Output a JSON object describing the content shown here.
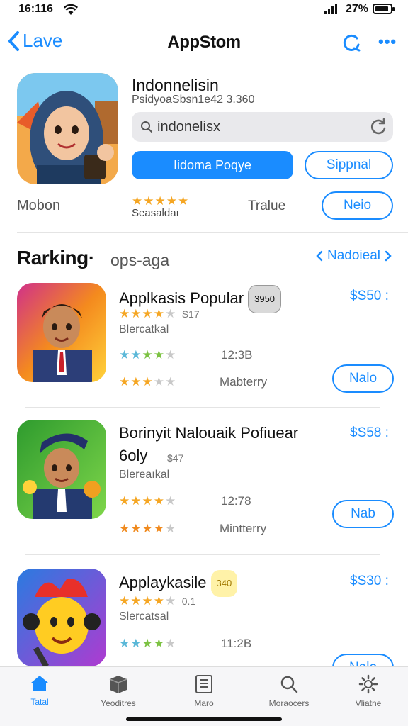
{
  "status": {
    "time": "16:116",
    "battery": "27%"
  },
  "nav": {
    "back_label": "Lave",
    "title": "AppStom"
  },
  "featured": {
    "title": "Indonnelisin",
    "subtitle": "PsidyoaSbsn1e42 3.360",
    "search_value": "indonelisx",
    "primary_button": "Iidoma Poqye",
    "secondary_button": "Sippnal",
    "left_label": "Mobon",
    "rating_stars": 5,
    "rating_label": "Seasaldaı",
    "middle_label": "Tralue",
    "action_button": "Neio"
  },
  "section": {
    "title": "Rarking·",
    "subtitle": "ops-aga",
    "link_label": "Nadoieal"
  },
  "apps": [
    {
      "name": "Applkasis Popular",
      "badge": "3950",
      "badge_color": "#d9d9d9",
      "price": "$S50 :",
      "stars": 4,
      "sub_meta": "S17",
      "category": "Blercatkal",
      "rating2_stars": 4,
      "time": "12:3B",
      "rating3_stars": 3,
      "info": "Mabterry",
      "button": "Nalo"
    },
    {
      "name": "Borinyit Nalouaik Pofiuear 6oly",
      "badge": "",
      "badge_color": "",
      "price": "$S58 :",
      "stars": 0,
      "sub_meta": "$47",
      "category": "Blereaıkal",
      "rating2_stars": 4,
      "time": "12:78",
      "rating3_stars": 4,
      "info": "Mintterry",
      "button": "Nab"
    },
    {
      "name": "Applaykasile",
      "badge": "340",
      "badge_color": "#fff2a8",
      "price": "$S30 :",
      "stars": 4,
      "sub_meta": "0.1",
      "category": "Slercatsal",
      "rating2_stars": 4,
      "time": "11:2B",
      "rating3_stars": 0,
      "info": "",
      "button": "Nalo"
    }
  ],
  "tabs": [
    {
      "label": "Tatal",
      "icon": "home-icon",
      "active": true
    },
    {
      "label": "Yeoditres",
      "icon": "box-icon",
      "active": false
    },
    {
      "label": "Maro",
      "icon": "list-icon",
      "active": false
    },
    {
      "label": "Moraocers",
      "icon": "search-icon",
      "active": false
    },
    {
      "label": "Vliatne",
      "icon": "gear-icon",
      "active": false
    }
  ],
  "colors": {
    "accent": "#1a8cff",
    "star_gold": "#f5a623",
    "star_green": "#7cc242",
    "star_gray": "#c8c8c8"
  }
}
